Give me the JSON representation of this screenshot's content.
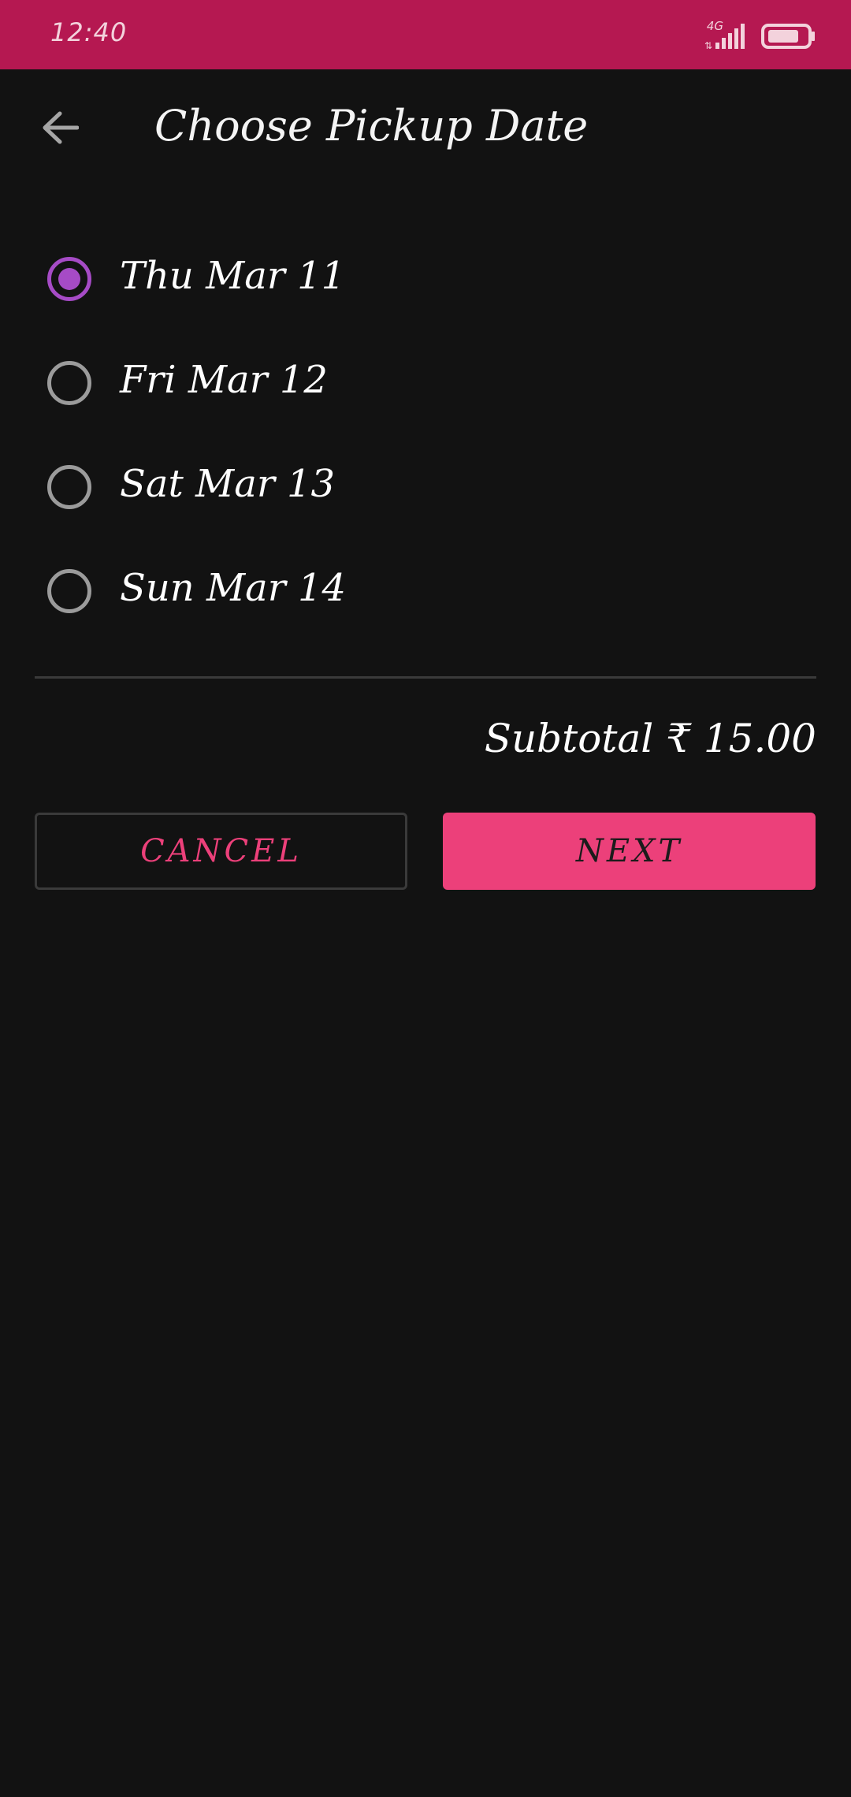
{
  "status_bar": {
    "time": "12:40",
    "network_type": "4G",
    "signal_icon": "cellular-signal-icon",
    "battery_icon": "battery-icon",
    "background_color": "#b51851"
  },
  "header": {
    "back_icon": "arrow-left-icon",
    "title": "Choose Pickup Date"
  },
  "date_options": [
    {
      "label": "Thu Mar 11",
      "selected": true
    },
    {
      "label": "Fri Mar 12",
      "selected": false
    },
    {
      "label": "Sat Mar 13",
      "selected": false
    },
    {
      "label": "Sun Mar 14",
      "selected": false
    }
  ],
  "summary": {
    "subtotal_text": "Subtotal ₹ 15.00"
  },
  "actions": {
    "cancel_label": "CANCEL",
    "next_label": "NEXT"
  },
  "colors": {
    "accent": "#ec407a",
    "radio_selected": "#a64bc6",
    "radio_unselected": "#9b9b9b",
    "background": "#121212"
  }
}
